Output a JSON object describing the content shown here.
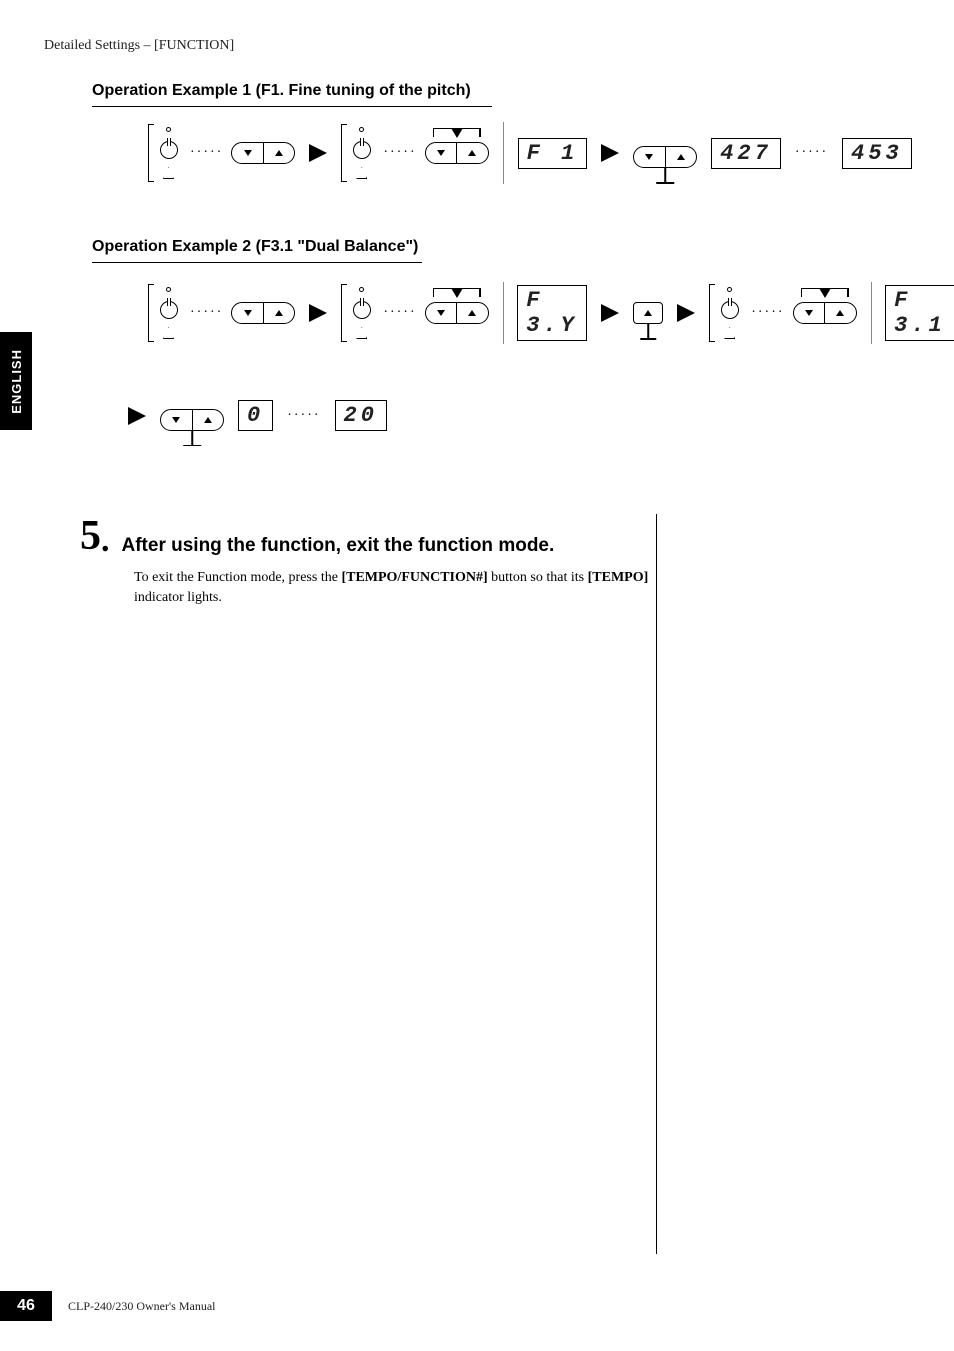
{
  "running_head": "Detailed Settings – [FUNCTION]",
  "side_tab": "ENGLISH",
  "example1": {
    "title": "Operation Example 1 (F1. Fine tuning of the pitch)",
    "display1": "F 1",
    "range_low": "427",
    "range_high": "453"
  },
  "example2": {
    "title": "Operation Example 2 (F3.1 \"Dual Balance\")",
    "display1": "F 3.Y",
    "display2": "F 3.1",
    "range_low": "  0",
    "range_high": " 20"
  },
  "step5": {
    "num": "5",
    "dot": ".",
    "heading": "After using the function, exit the function mode.",
    "body_prefix": "To exit the Function mode, press the ",
    "btn1": "[TEMPO/FUNCTION#]",
    "body_mid": " button so that its ",
    "btn2": "[TEMPO]",
    "body_suffix": " indicator lights."
  },
  "footer": {
    "page": "46",
    "doc": "CLP-240/230 Owner's Manual"
  },
  "dots": "·····"
}
